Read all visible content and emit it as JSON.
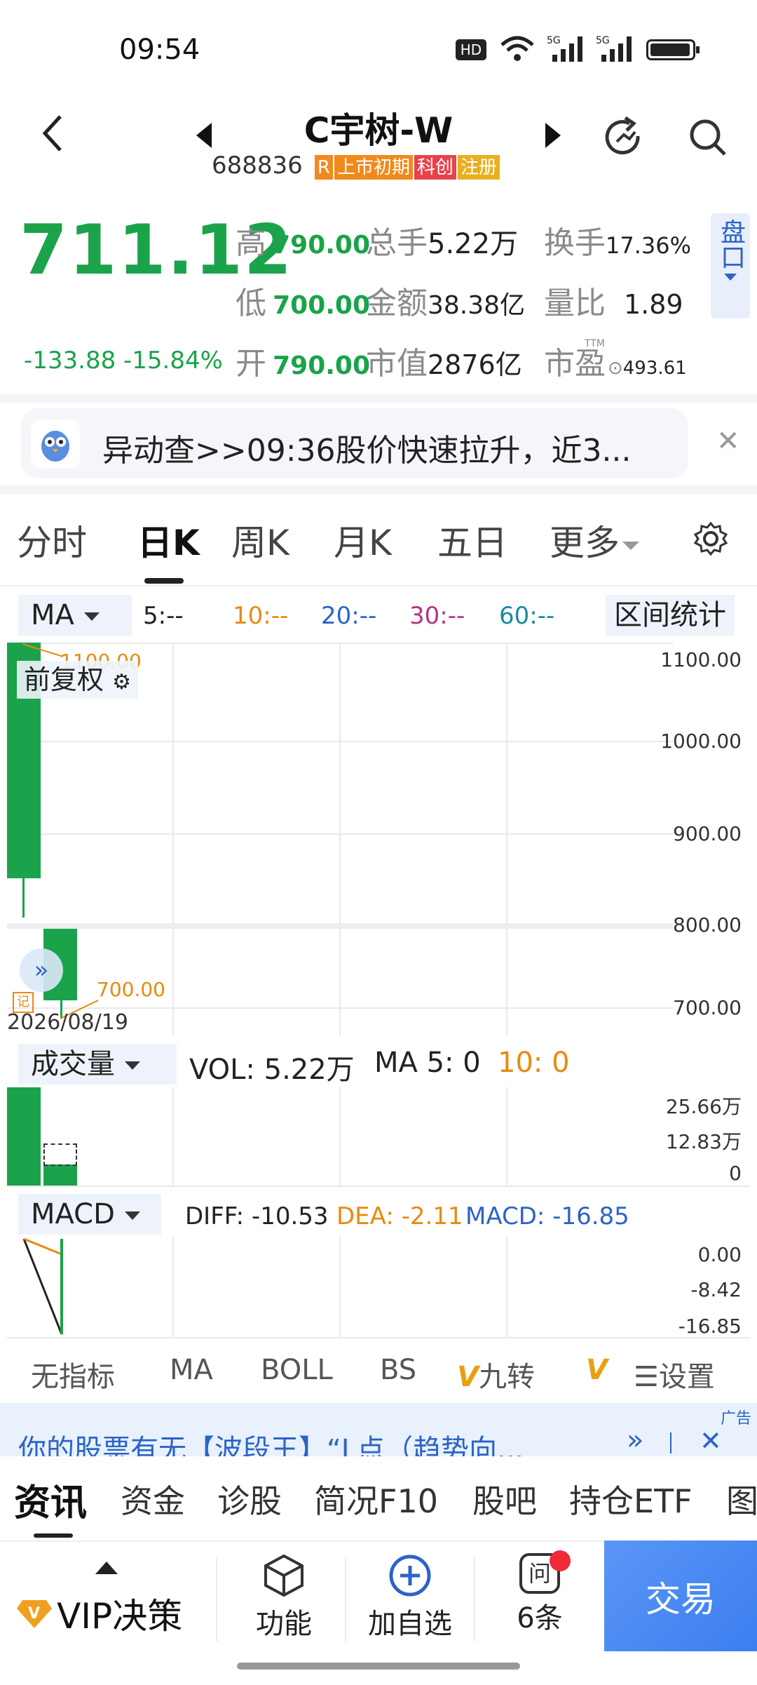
{
  "status_bar": {
    "time": "09:54",
    "hd_badge": "HD"
  },
  "header": {
    "title": "C宇树-W",
    "code": "688836",
    "badges": [
      {
        "text": "R",
        "color": "#f08a1c"
      },
      {
        "text": "上市初期",
        "color": "#f08a1c"
      },
      {
        "text": "科创",
        "color": "#e8424a"
      },
      {
        "text": "注册",
        "color": "#e8b020"
      }
    ]
  },
  "quote": {
    "price": "711.12",
    "change": "-133.88",
    "change_pct": "-15.84%",
    "high_label": "高",
    "high": "790.00",
    "low_label": "低",
    "low": "700.00",
    "open_label": "开",
    "open": "790.00",
    "volume_label": "总手",
    "volume": "5.22万",
    "amount_label": "金额",
    "amount": "38.38亿",
    "mktcap_label": "市值",
    "mktcap": "2876亿",
    "turnover_label": "换手",
    "turnover": "17.36%",
    "vol_ratio_label": "量比",
    "vol_ratio": "1.89",
    "pe_label": "市盈",
    "pe_tag": "TTM",
    "pe": "493.61",
    "pankou_label": "盘口"
  },
  "alert": {
    "text": "异动查>>09:36股价快速拉升，近3..."
  },
  "tabs": [
    "分时",
    "日K",
    "周K",
    "月K",
    "五日",
    "更多"
  ],
  "active_tab": "日K",
  "ma_row": {
    "selector": "MA",
    "ma5": "5:--",
    "ma10": "10:--",
    "ma20": "20:--",
    "ma30": "30:--",
    "ma60": "60:--",
    "range_stats": "区间统计"
  },
  "kline": {
    "fuquan": "前复权",
    "y_labels": [
      "1100.00",
      "1000.00",
      "900.00",
      "800.00",
      "700.00"
    ],
    "max_label": "1100.00",
    "min_label": "700.00",
    "date": "2026/08/19",
    "note_icon": "记"
  },
  "volume": {
    "selector": "成交量",
    "vol_text": "VOL: 5.22万",
    "ma5_text": "MA 5: 0",
    "ma10_text": "10: 0",
    "y_labels": [
      "25.66万",
      "12.83万",
      "0"
    ]
  },
  "macd": {
    "selector": "MACD",
    "diff": "DIFF: -10.53",
    "dea": "DEA: -2.11",
    "macd": "MACD: -16.85",
    "y_labels": [
      "0.00",
      "-8.42",
      "-16.85"
    ]
  },
  "indicators": [
    "无指标",
    "MA",
    "BOLL",
    "BS",
    "九转",
    "V"
  ],
  "indicator_settings": "设置",
  "ad": {
    "text": "你的股票有无【波段王】“L点（趋势向...",
    "tag": "广告"
  },
  "sub_tabs": [
    "资讯",
    "资金",
    "诊股",
    "简况F10",
    "股吧",
    "持仓ETF",
    "图"
  ],
  "bottom_nav": {
    "vip": "VIP决策",
    "func": "功能",
    "add": "加自选",
    "ask_count": "6条",
    "ask_icon_text": "问",
    "trade": "交易"
  },
  "colors": {
    "green": "#1aa34a",
    "accent_blue": "#2b64c8",
    "trade_blue": "#3c7ef0"
  }
}
